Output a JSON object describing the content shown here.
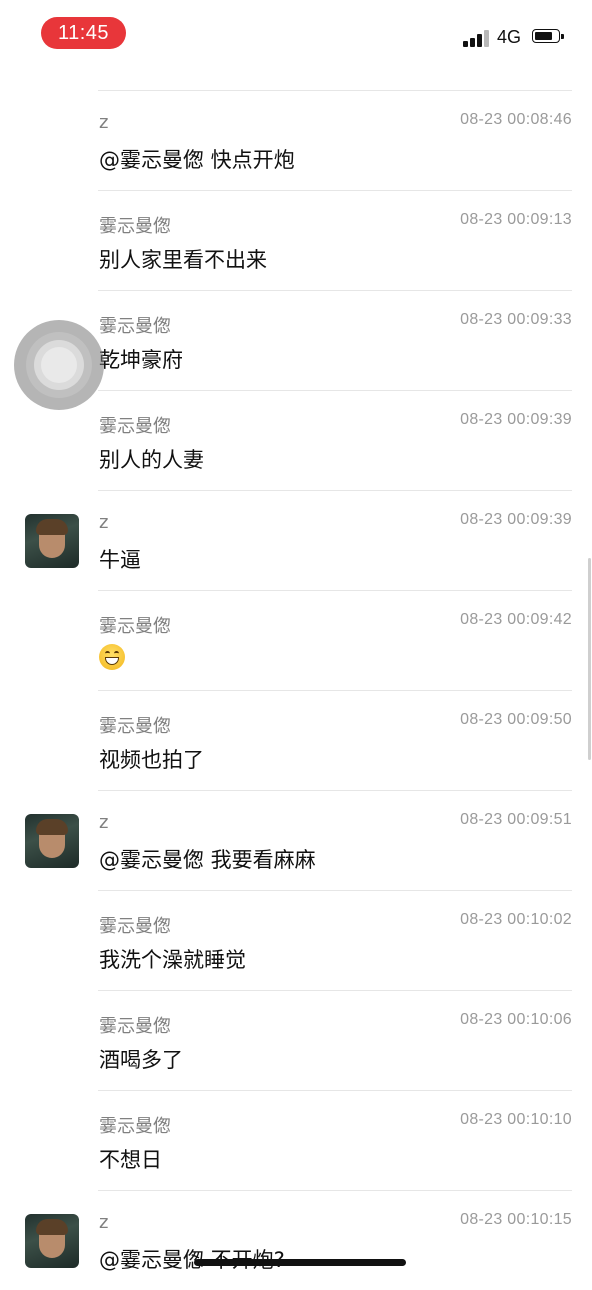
{
  "status_bar": {
    "time": "11:45",
    "network": "4G",
    "accent_color": "#e8363a"
  },
  "messages": [
    {
      "name": "z",
      "time": "08-23 00:08:46",
      "text": "@霎忈曼偬 快点开炮",
      "avatar": false
    },
    {
      "name": "霎忈曼偬",
      "time": "08-23 00:09:13",
      "text": "别人家里看不出来",
      "avatar": false
    },
    {
      "name": "霎忈曼偬",
      "time": "08-23 00:09:33",
      "text": "乾坤豪府",
      "avatar": false
    },
    {
      "name": "霎忈曼偬",
      "time": "08-23 00:09:39",
      "text": "别人的人妻",
      "avatar": false
    },
    {
      "name": "z",
      "time": "08-23 00:09:39",
      "text": "牛逼",
      "avatar": true
    },
    {
      "name": "霎忈曼偬",
      "time": "08-23 00:09:42",
      "text": "",
      "emoji": "grinning-face-emoji",
      "avatar": false
    },
    {
      "name": "霎忈曼偬",
      "time": "08-23 00:09:50",
      "text": "视频也拍了",
      "avatar": false
    },
    {
      "name": "z",
      "time": "08-23 00:09:51",
      "text": "@霎忈曼偬 我要看麻麻",
      "avatar": true
    },
    {
      "name": "霎忈曼偬",
      "time": "08-23 00:10:02",
      "text": "我洗个澡就睡觉",
      "avatar": false
    },
    {
      "name": "霎忈曼偬",
      "time": "08-23 00:10:06",
      "text": "酒喝多了",
      "avatar": false
    },
    {
      "name": "霎忈曼偬",
      "time": "08-23 00:10:10",
      "text": "不想日",
      "avatar": false
    },
    {
      "name": "z",
      "time": "08-23 00:10:15",
      "text": "@霎忈曼偬 不开炮?",
      "avatar": true
    }
  ]
}
